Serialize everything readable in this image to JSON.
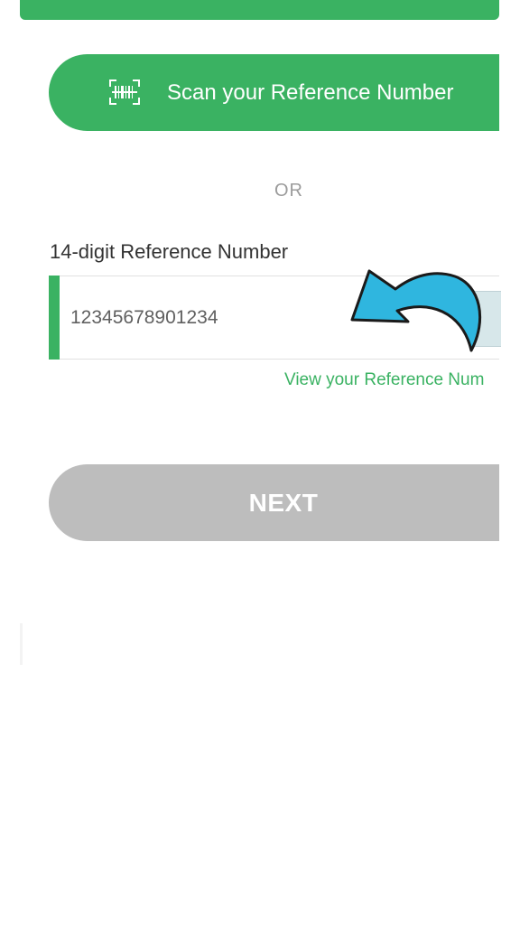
{
  "scan": {
    "label": "Scan your Reference Number",
    "icon": "barcode-scan-icon"
  },
  "separator": {
    "text": "OR"
  },
  "reference_field": {
    "label": "14-digit Reference Number",
    "value": "12345678901234",
    "thumbnail_icon": "reference-card-thumbnail"
  },
  "overlay": {
    "arrow_icon": "curved-arrow-pointer-icon",
    "arrow_color": "#2fb6df"
  },
  "view_link": {
    "text": "View your Reference Num"
  },
  "next": {
    "label": "NEXT"
  },
  "colors": {
    "primary_green": "#3ab262",
    "disabled_gray": "#bdbdbd"
  }
}
